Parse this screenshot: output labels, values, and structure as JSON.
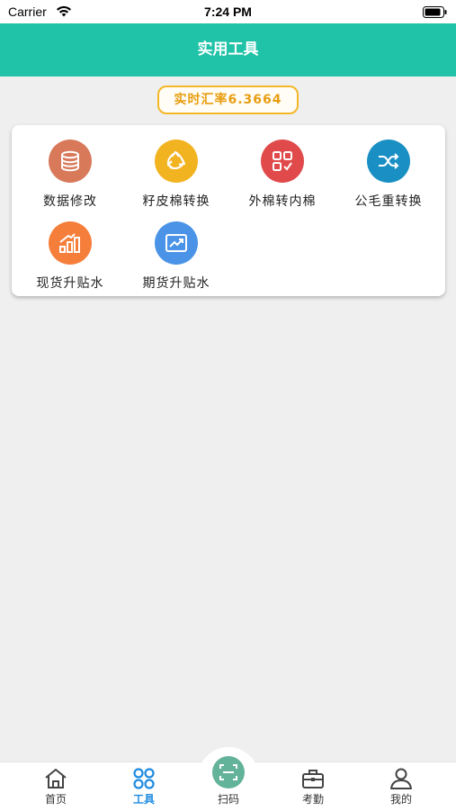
{
  "status_bar": {
    "carrier": "Carrier",
    "time": "7:24 PM"
  },
  "nav": {
    "title": "实用工具"
  },
  "exchange_rate": {
    "label": "实时汇率6.3664"
  },
  "tools": [
    {
      "label": "数据修改",
      "icon": "database-icon",
      "color": "#d8795a"
    },
    {
      "label": "籽皮棉转换",
      "icon": "recycle-icon",
      "color": "#f2b321"
    },
    {
      "label": "外棉转内棉",
      "icon": "qr-grid-icon",
      "color": "#e04a4a"
    },
    {
      "label": "公毛重转换",
      "icon": "shuffle-icon",
      "color": "#1a8fc4"
    },
    {
      "label": "现货升贴水",
      "icon": "bar-growth-icon",
      "color": "#f57f3a"
    },
    {
      "label": "期货升贴水",
      "icon": "trend-chart-icon",
      "color": "#4a93e6"
    }
  ],
  "tabbar": {
    "items": [
      {
        "label": "首页",
        "icon": "home-icon"
      },
      {
        "label": "工具",
        "icon": "grid-icon",
        "active": true
      },
      {
        "label": "扫码",
        "icon": "scan-icon"
      },
      {
        "label": "考勤",
        "icon": "briefcase-icon"
      },
      {
        "label": "我的",
        "icon": "user-icon"
      }
    ]
  },
  "colors": {
    "primary": "#20c3a8",
    "active_tab": "#1f8be0",
    "rate_border": "#f4b728",
    "rate_text": "#e89d10"
  }
}
